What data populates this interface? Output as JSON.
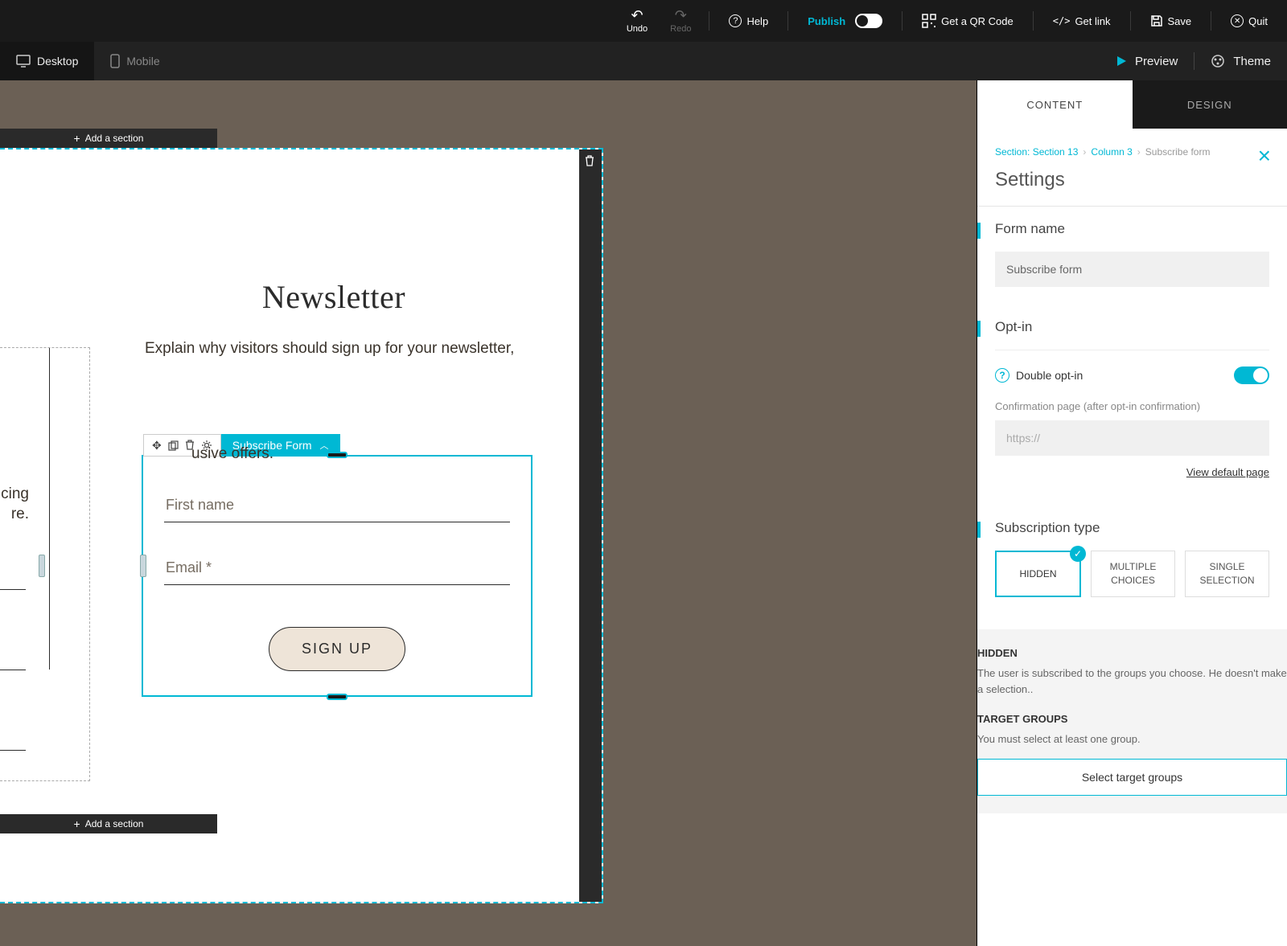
{
  "toolbar": {
    "undo": "Undo",
    "redo": "Redo",
    "help": "Help",
    "publish": "Publish",
    "qr": "Get a QR Code",
    "getlink": "Get link",
    "save": "Save",
    "quit": "Quit"
  },
  "devices": {
    "desktop": "Desktop",
    "mobile": "Mobile"
  },
  "secondbar": {
    "preview": "Preview",
    "theme": "Theme"
  },
  "canvas": {
    "add_section": "Add a section",
    "newsletter_title": "Newsletter",
    "newsletter_desc_1": "Explain why visitors should sign up for your newsletter,",
    "newsletter_desc_2": "usive offers.",
    "widget_label": "Subscribe Form",
    "first_name_ph": "First name",
    "email_ph": "Email *",
    "signup": "SIGN UP",
    "left_peek_1": "icing",
    "left_peek_2": "re."
  },
  "panel": {
    "tab_content": "CONTENT",
    "tab_design": "DESIGN",
    "crumb_section": "Section: Section 13",
    "crumb_column": "Column 3",
    "crumb_form": "Subscribe form",
    "title": "Settings",
    "form_name_head": "Form name",
    "form_name_value": "Subscribe form",
    "optin_head": "Opt-in",
    "double_optin": "Double opt-in",
    "conf_label": "Confirmation page (after opt-in confirmation)",
    "conf_ph": "https://",
    "view_default": "View default page",
    "subtype_head": "Subscription type",
    "subtype_hidden": "HIDDEN",
    "subtype_multi": "MULTIPLE CHOICES",
    "subtype_single": "SINGLE SELECTION",
    "info_title": "HIDDEN",
    "info_text": "The user is subscribed to the groups you choose. He doesn't make a selection..",
    "target_title": "TARGET GROUPS",
    "target_text": "You must select at least one group.",
    "select_groups": "Select target groups"
  }
}
